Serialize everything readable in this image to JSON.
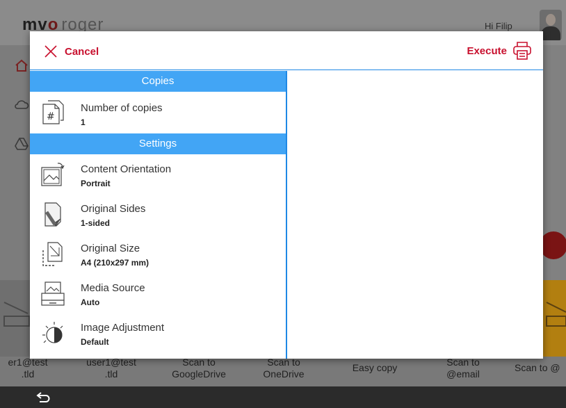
{
  "background": {
    "logo": {
      "part1": "mv",
      "part2": "o",
      "part3": "roger"
    },
    "greeting": "Hi Filip",
    "shortcuts": [
      {
        "label": "er1@test\n.tld"
      },
      {
        "label": "user1@test\n.tld"
      },
      {
        "label": "Scan to\nGoogleDrive"
      },
      {
        "label": "Scan to\nOneDrive"
      },
      {
        "label": "Easy copy"
      },
      {
        "label": "Scan to\n@email"
      },
      {
        "label": "Scan to @"
      }
    ]
  },
  "dialog": {
    "cancel_label": "Cancel",
    "execute_label": "Execute",
    "sections": [
      {
        "title": "Copies",
        "items": [
          {
            "title": "Number of copies",
            "value": "1",
            "icon": "copies-number-icon"
          }
        ]
      },
      {
        "title": "Settings",
        "items": [
          {
            "title": "Content Orientation",
            "value": "Portrait",
            "icon": "orientation-icon"
          },
          {
            "title": "Original Sides",
            "value": "1-sided",
            "icon": "original-sides-icon"
          },
          {
            "title": "Original Size",
            "value": "A4 (210x297 mm)",
            "icon": "original-size-icon"
          },
          {
            "title": "Media Source",
            "value": "Auto",
            "icon": "media-source-icon"
          },
          {
            "title": "Image Adjustment",
            "value": "Default",
            "icon": "image-adjustment-icon"
          }
        ]
      }
    ]
  },
  "colors": {
    "accent_red": "#c8102e",
    "accent_blue": "#42a5f5",
    "divider_blue": "#1e88e5"
  }
}
